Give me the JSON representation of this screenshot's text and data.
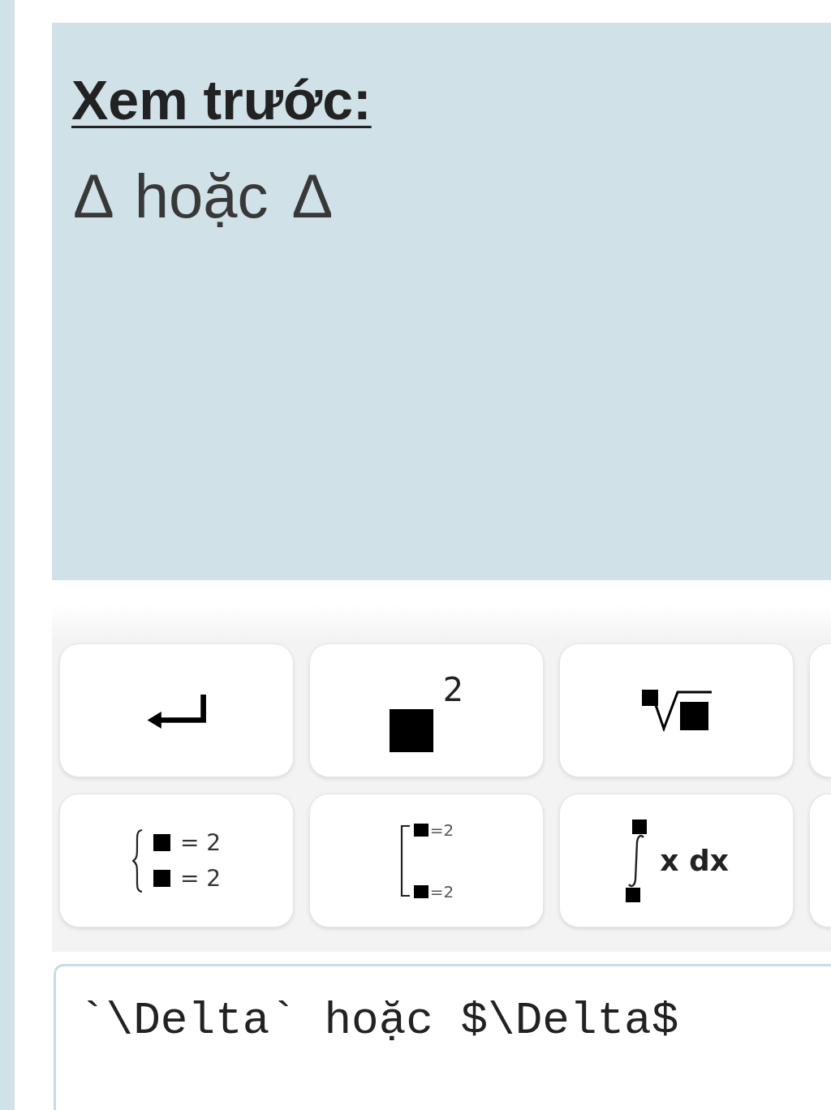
{
  "preview": {
    "heading": "Xem trước:",
    "content": "Δ hoặc Δ"
  },
  "keypad": {
    "rows": [
      [
        {
          "kind": "enter"
        },
        {
          "kind": "power",
          "exponent": "2"
        },
        {
          "kind": "root"
        }
      ],
      [
        {
          "kind": "system",
          "lines": [
            "= 2",
            "= 2"
          ]
        },
        {
          "kind": "bracket",
          "lines": [
            "=2",
            "=2"
          ]
        },
        {
          "kind": "integral",
          "integrand": "x dx"
        }
      ]
    ]
  },
  "editor": {
    "value": "`\\Delta` hoặc $\\Delta$"
  }
}
